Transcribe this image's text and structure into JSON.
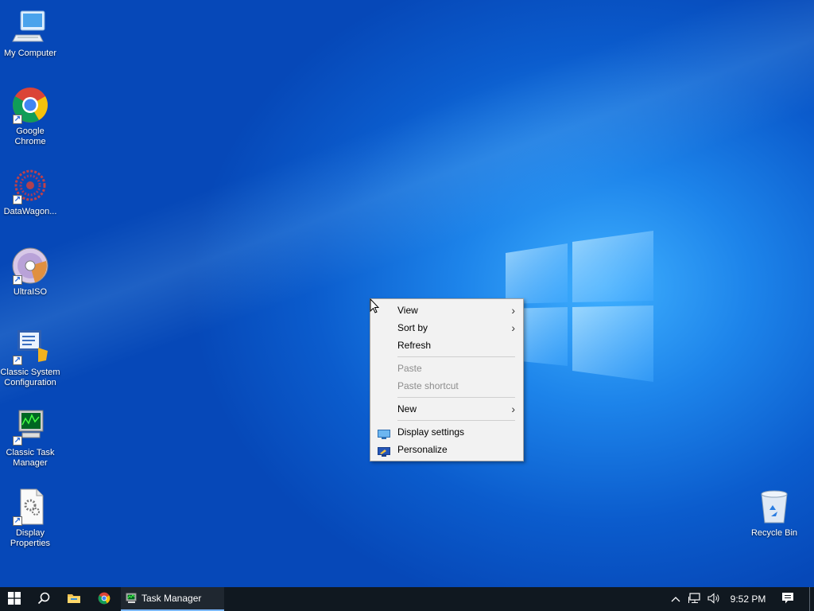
{
  "desktop_icons": [
    {
      "id": "my-computer",
      "label": "My Computer"
    },
    {
      "id": "google-chrome",
      "label": "Google Chrome"
    },
    {
      "id": "datawagon",
      "label": "DataWagon..."
    },
    {
      "id": "ultraiso",
      "label": "UltraISO"
    },
    {
      "id": "classic-system-configuration",
      "label": "Classic System Configuration"
    },
    {
      "id": "classic-task-manager",
      "label": "Classic Task Manager"
    },
    {
      "id": "display-properties",
      "label": "Display Properties"
    },
    {
      "id": "recycle-bin",
      "label": "Recycle Bin"
    }
  ],
  "context_menu": {
    "view": "View",
    "sort_by": "Sort by",
    "refresh": "Refresh",
    "paste": "Paste",
    "paste_shortcut": "Paste shortcut",
    "new": "New",
    "display_settings": "Display settings",
    "personalize": "Personalize"
  },
  "taskbar": {
    "active_task": "Task Manager",
    "clock": "9:52 PM"
  },
  "icons": [
    "windows-start-icon",
    "search-icon",
    "file-explorer-icon",
    "chrome-icon",
    "task-manager-icon",
    "chevron-up-icon",
    "network-icon",
    "volume-icon",
    "action-center-icon"
  ],
  "colors": {
    "taskbar": "#101820",
    "menu_bg": "#f2f2f2",
    "accent": "#7cb8ff"
  }
}
